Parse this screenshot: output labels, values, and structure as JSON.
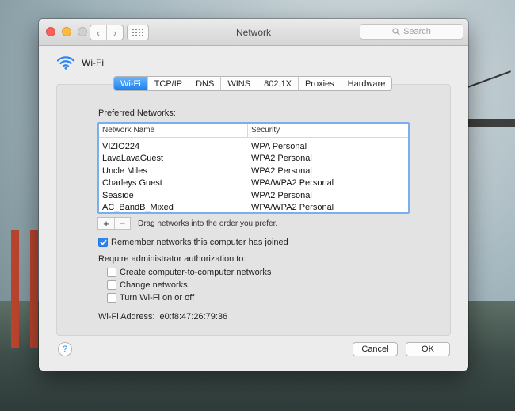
{
  "window": {
    "title": "Network",
    "search_placeholder": "Search",
    "nav_back": "‹",
    "nav_forward": "›"
  },
  "header": {
    "label": "Wi-Fi"
  },
  "tabs": [
    {
      "label": "Wi-Fi",
      "active": true
    },
    {
      "label": "TCP/IP",
      "active": false
    },
    {
      "label": "DNS",
      "active": false
    },
    {
      "label": "WINS",
      "active": false
    },
    {
      "label": "802.1X",
      "active": false
    },
    {
      "label": "Proxies",
      "active": false
    },
    {
      "label": "Hardware",
      "active": false
    }
  ],
  "preferred": {
    "label": "Preferred Networks:",
    "columns": {
      "name": "Network Name",
      "security": "Security"
    },
    "rows": [
      {
        "name": "VIZIO224",
        "security": "WPA Personal"
      },
      {
        "name": "LavaLavaGuest",
        "security": "WPA2 Personal"
      },
      {
        "name": "Uncle Miles",
        "security": "WPA2 Personal"
      },
      {
        "name": "Charleys Guest",
        "security": "WPA/WPA2 Personal"
      },
      {
        "name": "Seaside",
        "security": "WPA2 Personal"
      },
      {
        "name": "AC_BandB_Mixed",
        "security": "WPA/WPA2 Personal"
      }
    ],
    "add": "+",
    "remove": "−",
    "drag_hint": "Drag networks into the order you prefer."
  },
  "options": {
    "remember": {
      "label": "Remember networks this computer has joined",
      "checked": true
    },
    "require_label": "Require administrator authorization to:",
    "create": {
      "label": "Create computer-to-computer networks",
      "checked": false
    },
    "change": {
      "label": "Change networks",
      "checked": false
    },
    "toggle": {
      "label": "Turn Wi-Fi on or off",
      "checked": false
    }
  },
  "address": {
    "label": "Wi-Fi Address:",
    "value": "e0:f8:47:26:79:36"
  },
  "buttons": {
    "help": "?",
    "cancel": "Cancel",
    "ok": "OK"
  },
  "colors": {
    "accent": "#2e83f0",
    "tab_active": "#1b81ef"
  }
}
